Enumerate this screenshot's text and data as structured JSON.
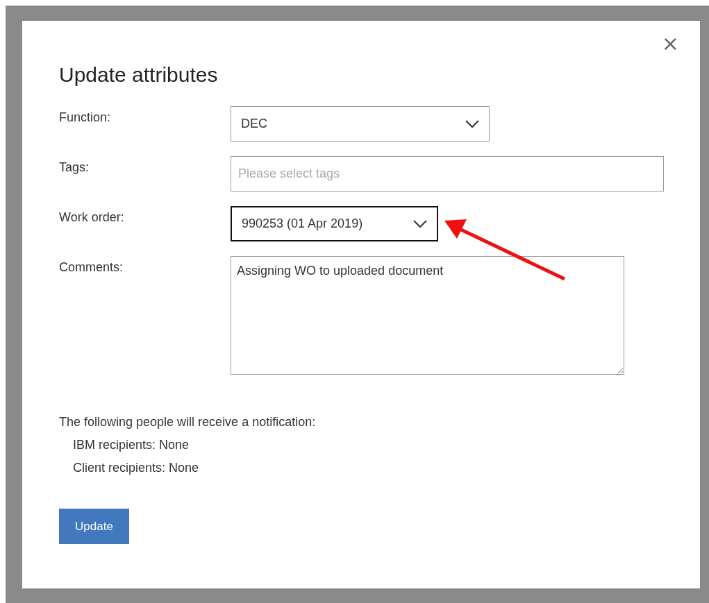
{
  "dialog": {
    "title": "Update attributes",
    "close": "×"
  },
  "fields": [
    {
      "kind": "select",
      "label": "Function:",
      "value": "DEC",
      "focused": false
    },
    {
      "kind": "tags",
      "label": "Tags:",
      "placeholder": "Please select tags",
      "focused": false
    },
    {
      "kind": "select",
      "label": "Work order:",
      "value": "990253 (01 Apr 2019)",
      "focused": true
    },
    {
      "kind": "textarea",
      "label": "Comments:",
      "value": "Assigning WO to uploaded document",
      "focused": false
    }
  ],
  "notification": {
    "heading": "The following people will receive a notification:",
    "lines": [
      "IBM recipients: None",
      "Client recipients: None"
    ]
  },
  "buttons": [
    {
      "label": "Update"
    }
  ]
}
